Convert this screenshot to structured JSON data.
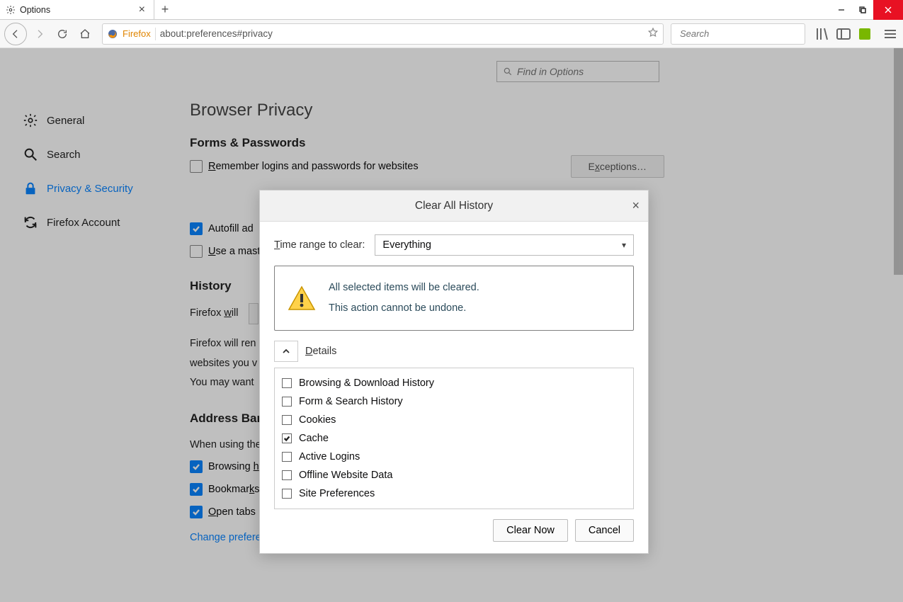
{
  "window": {
    "tab_title": "Options"
  },
  "toolbar": {
    "brand": "Firefox",
    "url": "about:preferences#privacy",
    "search_placeholder": "Search"
  },
  "findbar": {
    "placeholder": "Find in Options"
  },
  "sidebar": {
    "items": [
      {
        "label": "General"
      },
      {
        "label": "Search"
      },
      {
        "label": "Privacy & Security"
      },
      {
        "label": "Firefox Account"
      }
    ]
  },
  "page": {
    "heading": "Browser Privacy",
    "forms_heading": "Forms & Passwords",
    "remember_label": "Remember logins and passwords for websites",
    "exceptions_label": "Exceptions…",
    "autofill_label": "Autofill ad",
    "master_label": "Use a mast",
    "history_heading": "History",
    "firefox_will_pre": "Firefox ",
    "firefox_will_underline": "w",
    "firefox_will_post": "ill",
    "history_line1": "Firefox will ren",
    "history_line2": "websites you v",
    "history_line3": "You may want",
    "addressbar_heading": "Address Bar",
    "addressbar_intro": "When using the",
    "ab_browsing": "Browsing h",
    "ab_bookmarks": "Bookmarks",
    "ab_opentabs": "Open tabs",
    "ab_link": "Change preferences for search engine suggestions"
  },
  "dialog": {
    "title": "Clear All History",
    "time_label_pre": "T",
    "time_label_post": "ime range to clear:",
    "time_value": "Everything",
    "warn_line1": "All selected items will be cleared.",
    "warn_line2": "This action cannot be undone.",
    "details_pre": "D",
    "details_post": "etails",
    "items": [
      {
        "label": "Browsing & Download History",
        "checked": false
      },
      {
        "label": "Form & Search History",
        "checked": false
      },
      {
        "label": "Cookies",
        "checked": false
      },
      {
        "label": "Cache",
        "checked": true
      },
      {
        "label": "Active Logins",
        "checked": false
      },
      {
        "label": "Offline Website Data",
        "checked": false
      },
      {
        "label": "Site Preferences",
        "checked": false
      }
    ],
    "clear_btn": "Clear Now",
    "cancel_btn": "Cancel"
  }
}
